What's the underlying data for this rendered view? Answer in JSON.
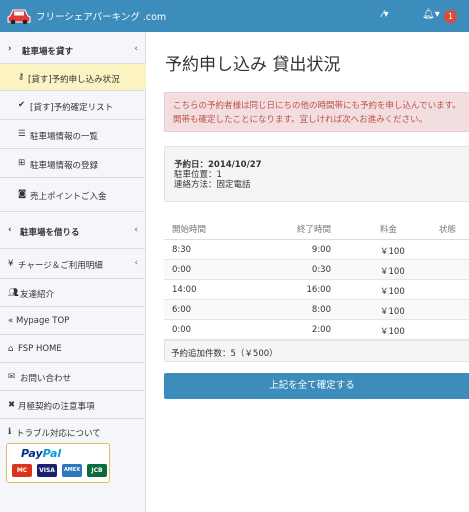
{
  "header": {
    "brand": "フリーシェアパーキング .com",
    "tools_icon": "magic-wand-icon",
    "bell_icon": "bell-icon",
    "badge_count": "1"
  },
  "sidebar": {
    "lend_section": "駐車場を貸す",
    "lend_items": [
      "[貸す]予約申し込み状況",
      "[貸す]予約確定リスト",
      "駐車場情報の一覧",
      "駐車場情報の登録",
      "売上ポイントご入金"
    ],
    "rent_section": "駐車場を借りる",
    "charge": "チャージ＆ご利用明細",
    "friend": "友達紹介",
    "mypage": "Mypage TOP",
    "fsp_home": "FSP HOME",
    "contact": "お問い合わせ",
    "monthly": "月極契約の注意事項",
    "trouble": "トラブル対応について",
    "paypal": {
      "brand_a": "Pay",
      "brand_b": "Pal",
      "cards": [
        "MC",
        "VISA",
        "AMEX",
        "JCB"
      ]
    }
  },
  "main": {
    "title": "予約申し込み 貸出状況",
    "alert_line1": "こちらの予約者様は同じ日にちの他の時間帯にも予約を申し込んでいます。",
    "alert_line2": "開帯も確定したことになります。宜しければ次へお進みください。",
    "info": {
      "date": "予約日：2014/10/27",
      "position": "駐車位置：1",
      "contact": "連絡方法：固定電話"
    },
    "table": {
      "headers": [
        "開始時間",
        "終了時間",
        "料金",
        "状態"
      ],
      "rows": [
        {
          "start": "8:30",
          "end": "9:00",
          "fee": "￥100"
        },
        {
          "start": "0:00",
          "end": "0:30",
          "fee": "￥100"
        },
        {
          "start": "14:00",
          "end": "16:00",
          "fee": "￥100"
        },
        {
          "start": "6:00",
          "end": "8:00",
          "fee": "￥100"
        },
        {
          "start": "0:00",
          "end": "2:00",
          "fee": "￥100"
        }
      ],
      "footer": "予約追加件数：5（￥500）"
    },
    "confirm_button": "上記を全て確定する"
  },
  "colors": {
    "header_bg": "#3c8dbc",
    "active_item_bg": "#fbf3c2",
    "alert_text": "#c0504d",
    "badge": "#dd4b39"
  }
}
